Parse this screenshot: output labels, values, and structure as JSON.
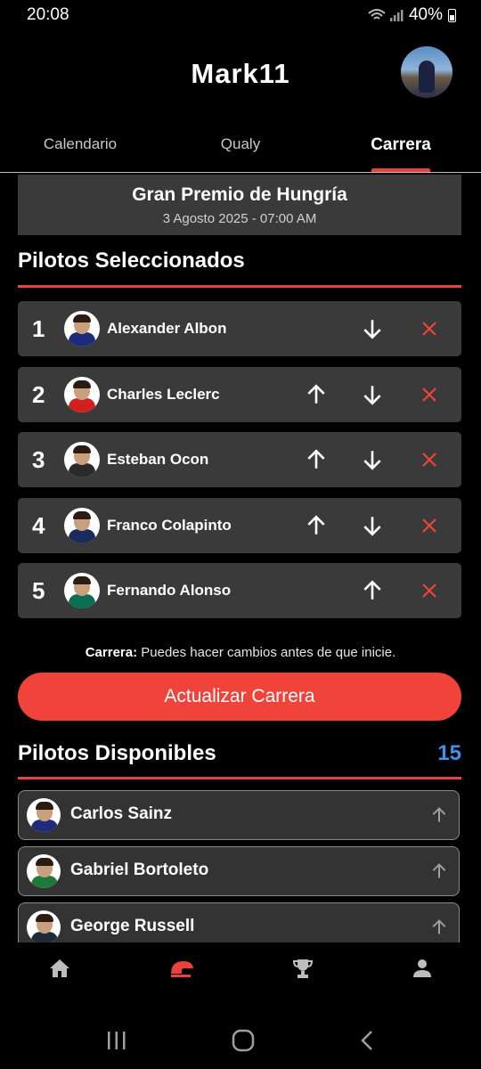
{
  "status": {
    "time": "20:08",
    "battery": "40%"
  },
  "header": {
    "title": "Mark11"
  },
  "tabs": [
    {
      "label": "Calendario",
      "active": false
    },
    {
      "label": "Qualy",
      "active": false
    },
    {
      "label": "Carrera",
      "active": true
    }
  ],
  "race": {
    "name": "Gran Premio de Hungría",
    "date": "3 Agosto 2025 - 07:00 AM"
  },
  "selected": {
    "title": "Pilotos Seleccionados",
    "drivers": [
      {
        "pos": "1",
        "name": "Alexander Albon",
        "can_up": false,
        "can_down": true,
        "suit": "#1e2a7a"
      },
      {
        "pos": "2",
        "name": "Charles Leclerc",
        "can_up": true,
        "can_down": true,
        "suit": "#d21f1f"
      },
      {
        "pos": "3",
        "name": "Esteban Ocon",
        "can_up": true,
        "can_down": true,
        "suit": "#2a2a2a"
      },
      {
        "pos": "4",
        "name": "Franco Colapinto",
        "can_up": true,
        "can_down": true,
        "suit": "#1b2a5c"
      },
      {
        "pos": "5",
        "name": "Fernando Alonso",
        "can_up": true,
        "can_down": false,
        "suit": "#0a6e55"
      }
    ]
  },
  "note": {
    "label": "Carrera:",
    "text": " Puedes hacer cambios antes de que inicie."
  },
  "cta": {
    "label": "Actualizar Carrera"
  },
  "available": {
    "title": "Pilotos Disponibles",
    "count": "15",
    "drivers": [
      {
        "name": "Carlos Sainz",
        "suit": "#1e2a7a"
      },
      {
        "name": "Gabriel Bortoleto",
        "suit": "#1f7a3a"
      },
      {
        "name": "George Russell",
        "suit": "#1d2b3a"
      }
    ]
  },
  "colors": {
    "accent": "#f0433a",
    "count": "#3b93f0",
    "card": "#3a3a3a"
  },
  "bottom_nav": [
    "home-icon",
    "race-helmet-icon",
    "trophy-icon",
    "profile-icon"
  ],
  "system_nav": [
    "recents-icon",
    "home-circle-icon",
    "back-icon"
  ]
}
